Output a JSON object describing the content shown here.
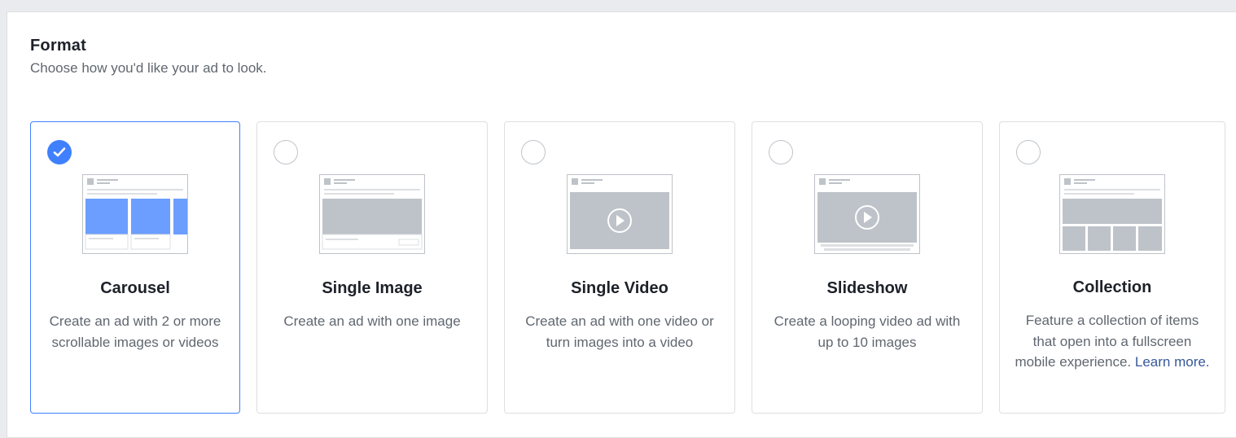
{
  "header": {
    "title": "Format",
    "subtitle": "Choose how you'd like your ad to look."
  },
  "formats": [
    {
      "title": "Carousel",
      "description": "Create an ad with 2 or more scrollable images or videos",
      "selected": true,
      "thumbnail_icon": "carousel-preview-icon"
    },
    {
      "title": "Single Image",
      "description": "Create an ad with one image",
      "selected": false,
      "thumbnail_icon": "single-image-preview-icon"
    },
    {
      "title": "Single Video",
      "description": "Create an ad with one video or turn images into a video",
      "selected": false,
      "thumbnail_icon": "single-video-preview-icon"
    },
    {
      "title": "Slideshow",
      "description": "Create a looping video ad with up to 10 images",
      "selected": false,
      "thumbnail_icon": "slideshow-preview-icon"
    },
    {
      "title": "Collection",
      "description": "Feature a collection of items that open into a fullscreen mobile experience.",
      "link_text": "Learn more.",
      "selected": false,
      "thumbnail_icon": "collection-preview-icon"
    }
  ],
  "colors": {
    "accent": "#4080ff",
    "link": "#365899",
    "muted_text": "#606770",
    "placeholder_gray": "#bec3c9"
  }
}
